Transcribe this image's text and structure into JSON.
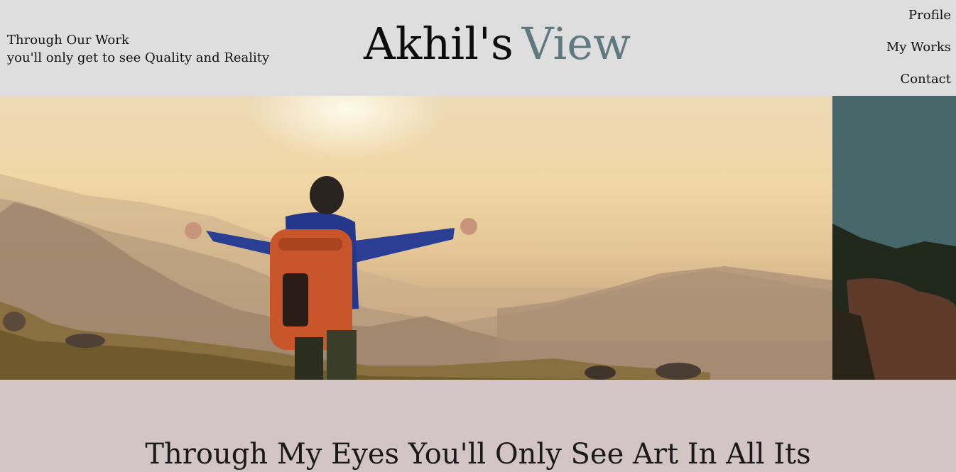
{
  "header": {
    "tagline_line1": "Through Our Work",
    "tagline_line2": "you'll only get to see Quality and Reality",
    "brand_part1": "Akhil's",
    "brand_part2": "View",
    "nav": [
      "Profile",
      "My Works",
      "Contact"
    ]
  },
  "colors": {
    "header_bg": "#dedede",
    "brand_accent": "#5f7a7f",
    "section_bg": "#d3c4c5"
  },
  "slider": {
    "slides": [
      "hiker-with-orange-backpack-on-mountain",
      "coastline-cliff"
    ]
  },
  "section": {
    "heading": "Through My Eyes You'll Only See Art In All Its"
  }
}
